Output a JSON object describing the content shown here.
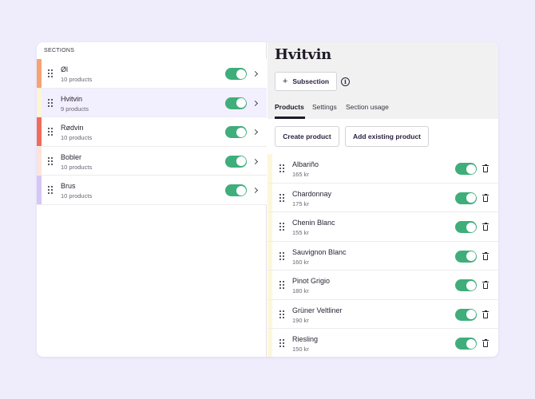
{
  "sidebar": {
    "heading": "SECTIONS",
    "sections": [
      {
        "name": "Øl",
        "count": "10 products",
        "color": "#f6a374",
        "enabled": true
      },
      {
        "name": "Hvitvin",
        "count": "9 products",
        "color": "#fdf5d3",
        "enabled": true
      },
      {
        "name": "Rødvin",
        "count": "10 products",
        "color": "#f06b5b",
        "enabled": true
      },
      {
        "name": "Bobler",
        "count": "10 products",
        "color": "#fce4da",
        "enabled": true
      },
      {
        "name": "Brus",
        "count": "10 products",
        "color": "#d6c6f6",
        "enabled": true
      }
    ],
    "selected_index": 1
  },
  "detail": {
    "title": "Hvitvin",
    "subsection_button": {
      "icon": "plus-icon",
      "label": "Subsection"
    },
    "info_icon": "i",
    "tabs": [
      {
        "label": "Products",
        "active": true
      },
      {
        "label": "Settings",
        "active": false
      },
      {
        "label": "Section usage",
        "active": false
      }
    ],
    "actions": {
      "create_product": "Create product",
      "add_existing_product": "Add existing product"
    },
    "products": [
      {
        "name": "Albariño",
        "price": "165 kr",
        "enabled": true
      },
      {
        "name": "Chardonnay",
        "price": "175 kr",
        "enabled": true
      },
      {
        "name": "Chenin Blanc",
        "price": "155 kr",
        "enabled": true
      },
      {
        "name": "Sauvignon Blanc",
        "price": "160 kr",
        "enabled": true
      },
      {
        "name": "Pinot Grigio",
        "price": "180 kr",
        "enabled": true
      },
      {
        "name": "Grüner Veltliner",
        "price": "190 kr",
        "enabled": true
      },
      {
        "name": "Riesling",
        "price": "150 kr",
        "enabled": true
      }
    ]
  },
  "colors": {
    "page_background": "#efecfc",
    "selected_row": "#f2effe",
    "toggle_on": "#3fae7a",
    "product_strip": "#fdf7da"
  }
}
